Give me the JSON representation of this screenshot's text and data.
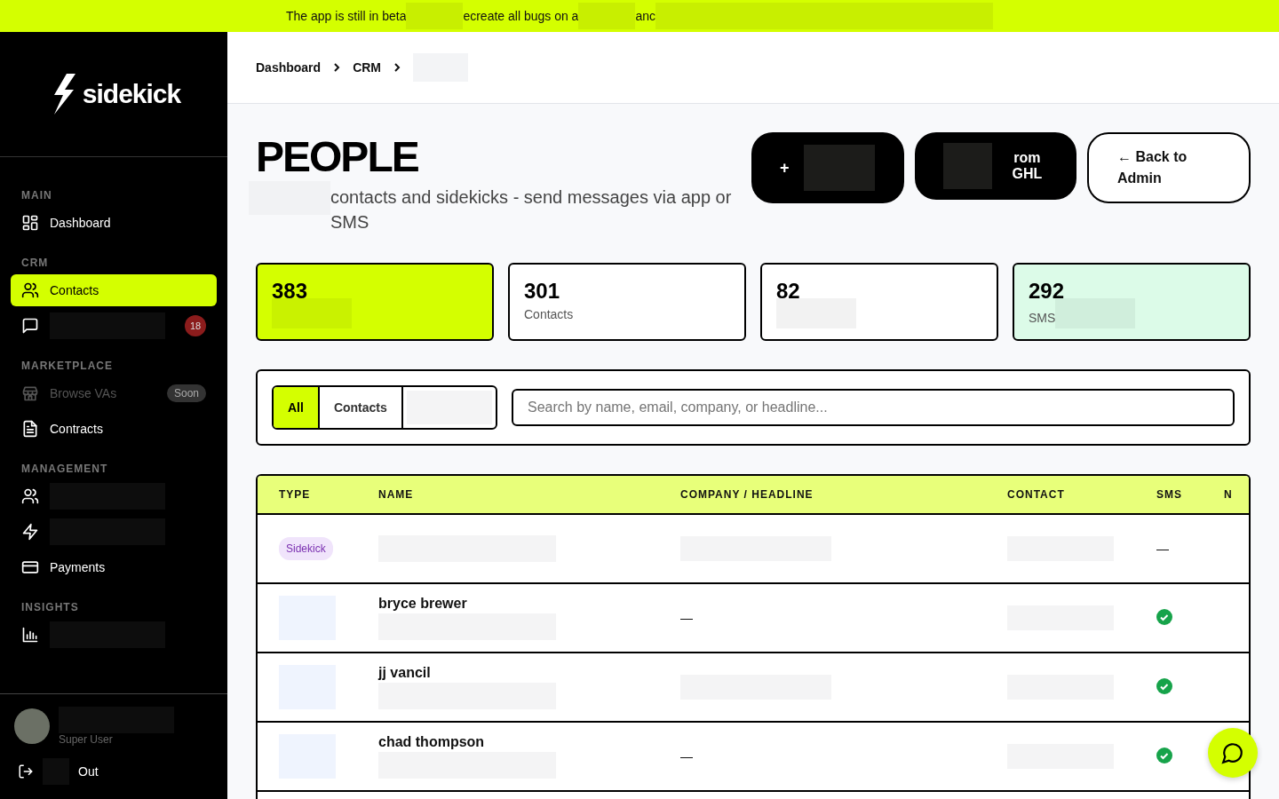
{
  "banner": {
    "parts": [
      {
        "kind": "text",
        "text": "The app is still in beta"
      },
      {
        "kind": "redacted"
      },
      {
        "kind": "text",
        "text": "ecreate all bugs on a"
      },
      {
        "kind": "redacted"
      },
      {
        "kind": "text",
        "text": "anc"
      },
      {
        "kind": "redacted"
      },
      {
        "kind": "redacted"
      }
    ]
  },
  "sidebar": {
    "logo": "sidekick",
    "sections": [
      {
        "title": "MAIN",
        "items": [
          {
            "kind": "item",
            "label": "Dashboard",
            "selected": false,
            "disabled": false
          }
        ]
      },
      {
        "title": "CRM",
        "items": [
          {
            "kind": "item",
            "label": "Contacts",
            "selected": true,
            "disabled": false
          },
          {
            "kind": "redacted",
            "selected": false,
            "disabled": false,
            "badge": "18"
          }
        ]
      },
      {
        "title": "MARKETPLACE",
        "items": [
          {
            "kind": "item",
            "label": "Browse VAs",
            "selected": false,
            "disabled": true,
            "tag": "Soon"
          },
          {
            "kind": "item",
            "label": "Contracts",
            "selected": false,
            "disabled": false
          }
        ]
      },
      {
        "title": "MANAGEMENT",
        "items": [
          {
            "kind": "redacted",
            "selected": false,
            "disabled": false
          },
          {
            "kind": "redacted",
            "selected": false,
            "disabled": false
          },
          {
            "kind": "item",
            "label": "Payments",
            "selected": false,
            "disabled": false
          }
        ]
      },
      {
        "title": "INSIGHTS",
        "items": [
          {
            "kind": "redacted",
            "selected": false,
            "disabled": false
          }
        ]
      }
    ],
    "user": {
      "role": "Super User"
    },
    "logout": "Out"
  },
  "breadcrumb": [
    {
      "kind": "text",
      "text": "Dashboard"
    },
    {
      "kind": "text",
      "text": "CRM"
    },
    {
      "kind": "redacted"
    }
  ],
  "page": {
    "title": "PEOPLE",
    "subtitle": "contacts and sidekicks - send messages via app or SMS",
    "buttons": [
      {
        "kind": "add",
        "icon": "+"
      },
      {
        "kind": "import",
        "label": "rom GHL"
      },
      {
        "kind": "back",
        "label": "← Back to Admin"
      }
    ]
  },
  "stats": [
    {
      "value": "383",
      "color": "#d4ff00"
    },
    {
      "value": "301",
      "label": "Contacts",
      "color": "#ffffff"
    },
    {
      "value": "82",
      "color": "#ffffff"
    },
    {
      "value": "292",
      "label": "SMS",
      "color": "#dcfbe8"
    }
  ],
  "filters": {
    "tabs": [
      {
        "label": "All",
        "selected": true
      },
      {
        "label": "Contacts",
        "selected": false
      },
      {
        "selected": false
      }
    ],
    "search": {
      "placeholder": "Search by name, email, company, or headline..."
    }
  },
  "table": {
    "columns": [
      "TYPE",
      "NAME",
      "COMPANY / HEADLINE",
      "CONTACT",
      "SMS",
      "N"
    ],
    "rows": [
      {
        "type": "Sidekick",
        "company": null,
        "sms": "—",
        "sms_ok": false
      },
      {
        "name": "bryce brewer",
        "company": "—",
        "sms_ok": true
      },
      {
        "name": "jj vancil",
        "company": null,
        "sms_ok": true
      },
      {
        "name": "chad thompson",
        "company": "—",
        "sms_ok": true
      }
    ]
  }
}
